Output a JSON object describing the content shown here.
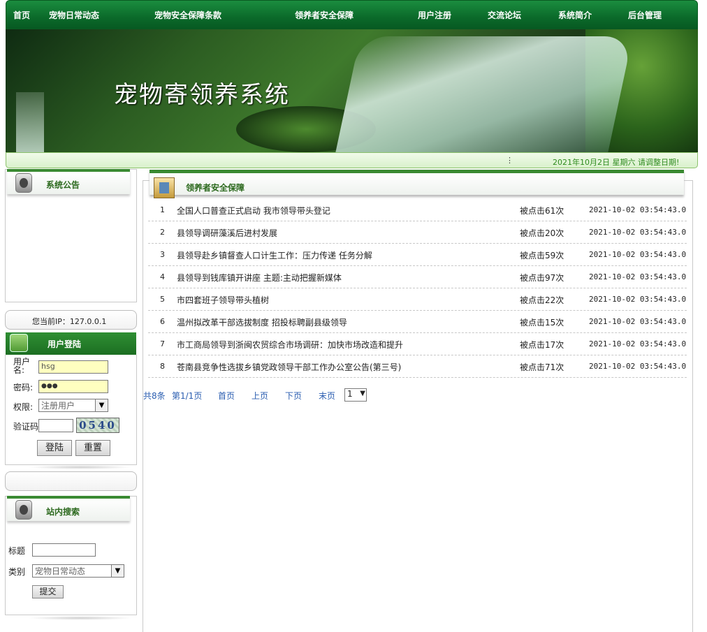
{
  "nav": {
    "items": [
      "首页",
      "宠物日常动态",
      "宠物安全保障条款",
      "领养者安全保障",
      "用户注册",
      "交流论坛",
      "系统简介",
      "后台管理"
    ]
  },
  "banner": {
    "title": "宠物寄领养系统"
  },
  "marquee": {
    "dot": "⋮",
    "text": "2021年10月2日 星期六    请调整日期!"
  },
  "notice": {
    "title": "系统公告"
  },
  "ip": {
    "text": "您当前IP：127.0.0.1"
  },
  "login": {
    "title": "用户登陆",
    "username_label": "用户名:",
    "username_value": "hsg",
    "password_label": "密码:",
    "password_value": "●●●",
    "role_label": "权限:",
    "role_value": "注册用户",
    "captcha_label": "验证码",
    "captcha_text": "0540",
    "login_button": "登陆",
    "reset_button": "重置"
  },
  "search": {
    "title": "站内搜索",
    "title_label": "标题",
    "category_label": "类别",
    "category_value": "宠物日常动态",
    "submit": "提交"
  },
  "main": {
    "title": "领养者安全保障",
    "rows": [
      {
        "n": "1",
        "title": "全国人口普查正式启动 我市领导带头登记",
        "clicks": "被点击61次",
        "date": "2021-10-02 03:54:43.0"
      },
      {
        "n": "2",
        "title": "县领导调研藻溪后进村发展",
        "clicks": "被点击20次",
        "date": "2021-10-02 03:54:43.0"
      },
      {
        "n": "3",
        "title": "县领导赴乡镇督查人口计生工作：压力传递 任务分解",
        "clicks": "被点击59次",
        "date": "2021-10-02 03:54:43.0"
      },
      {
        "n": "4",
        "title": "县领导到钱库镇开讲座 主题:主动把握新媒体",
        "clicks": "被点击97次",
        "date": "2021-10-02 03:54:43.0"
      },
      {
        "n": "5",
        "title": "市四套班子领导带头植树",
        "clicks": "被点击22次",
        "date": "2021-10-02 03:54:43.0"
      },
      {
        "n": "6",
        "title": "温州拟改革干部选拔制度 招投标聘副县级领导",
        "clicks": "被点击15次",
        "date": "2021-10-02 03:54:43.0"
      },
      {
        "n": "7",
        "title": "市工商局领导到浙闽农贸综合市场调研：加快市场改造和提升",
        "clicks": "被点击17次",
        "date": "2021-10-02 03:54:43.0"
      },
      {
        "n": "8",
        "title": "苍南县竞争性选拔乡镇党政领导干部工作办公室公告(第三号)",
        "clicks": "被点击71次",
        "date": "2021-10-02 03:54:43.0"
      }
    ],
    "pager": {
      "total": "共8条",
      "page": "第1/1页",
      "first": "首页",
      "prev": "上页",
      "next": "下页",
      "last": "末页",
      "select": "1"
    }
  }
}
